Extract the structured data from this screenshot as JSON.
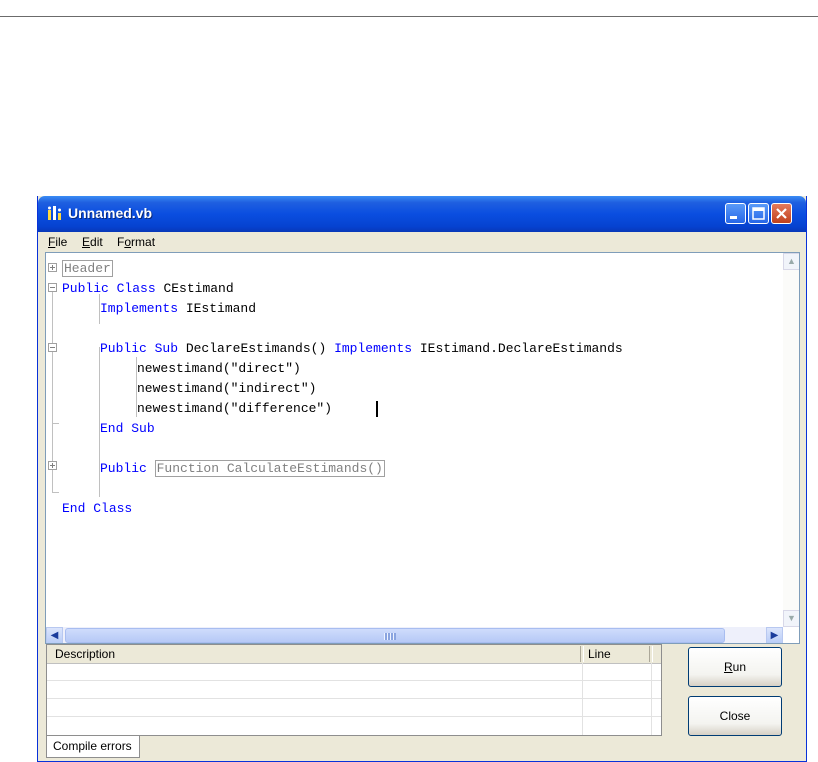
{
  "window": {
    "title": "Unnamed.vb",
    "controls": [
      "minimize-icon",
      "maximize-icon",
      "close-icon"
    ]
  },
  "menu": {
    "items": [
      {
        "label": "File",
        "mnemonic": "F",
        "rest": "ile"
      },
      {
        "label": "Edit",
        "mnemonic": "E",
        "rest": "dit"
      },
      {
        "label": "Format",
        "mnemonic": "o",
        "rest_before": "F",
        "rest": "rmat"
      }
    ]
  },
  "editor": {
    "lines": {
      "l0": {
        "collapsed": "Header"
      },
      "l1": {
        "kw1": "Public",
        "kw2": "Class",
        "text": " CEstimand"
      },
      "l2": {
        "kw1": "Implements",
        "text": " IEstimand"
      },
      "l4": {
        "kw1": "Public",
        "kw2": "Sub",
        "text1": " DeclareEstimands() ",
        "kw3": "Implements",
        "text2": " IEstimand.DeclareEstimands"
      },
      "l5": {
        "text": "newestimand(\"direct\")"
      },
      "l6": {
        "text": "newestimand(\"indirect\")"
      },
      "l7": {
        "text": "newestimand(\"difference\")"
      },
      "l8": {
        "kw1": "End",
        "kw2": "Sub"
      },
      "l10": {
        "kw1": "Public",
        "collapsed": "Function CalculateEstimands()"
      },
      "l12": {
        "kw1": "End",
        "kw2": "Class"
      }
    }
  },
  "errors": {
    "columns": {
      "description": "Description",
      "line": "Line"
    },
    "rows": []
  },
  "tabs": {
    "compile_errors": "Compile errors"
  },
  "buttons": {
    "run": {
      "mnemonic": "R",
      "rest": "un"
    },
    "close": "Close"
  }
}
